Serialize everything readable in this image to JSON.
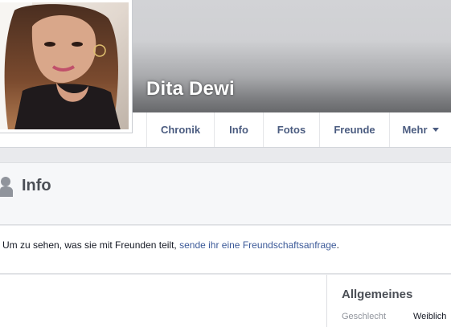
{
  "profile": {
    "name": "Dita Dewi"
  },
  "nav": {
    "tabs": [
      {
        "label": "Chronik"
      },
      {
        "label": "Info"
      },
      {
        "label": "Fotos"
      },
      {
        "label": "Freunde"
      },
      {
        "label": "Mehr"
      }
    ]
  },
  "info": {
    "title": "Info",
    "message_prefix": "Um zu sehen, was sie mit Freunden teilt, ",
    "message_link": "sende ihr eine Freundschaftsanfrage",
    "message_suffix": "."
  },
  "general": {
    "title": "Allgemeines",
    "fields": [
      {
        "label": "Geschlecht",
        "value": "Weiblich"
      }
    ]
  },
  "colors": {
    "link": "#3b5998",
    "nav_text": "#4b5c80",
    "heading": "#4b4f56"
  },
  "icons": {
    "info_section": "person-icon",
    "more_menu": "caret-down-icon"
  }
}
